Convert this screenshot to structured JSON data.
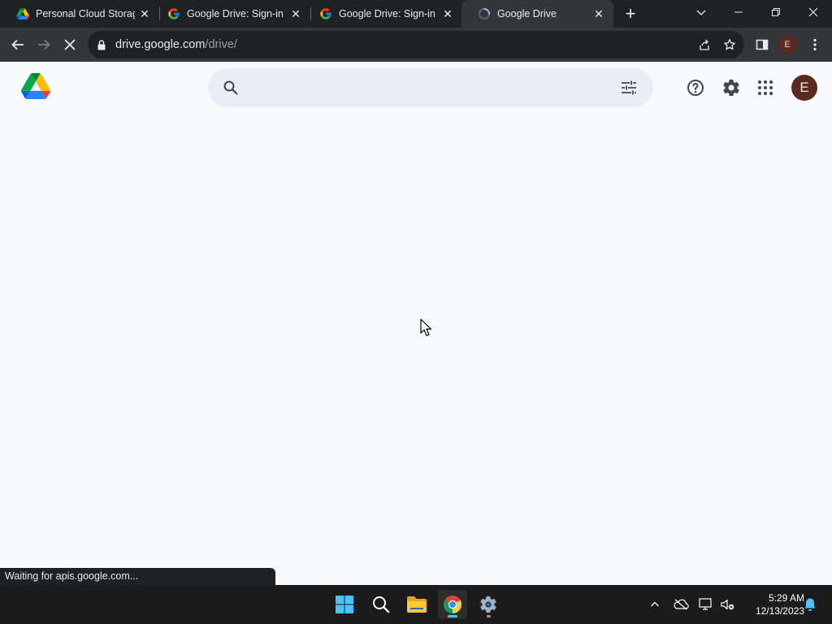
{
  "browser": {
    "tabs": [
      {
        "title": "Personal Cloud Storage",
        "favicon": "google-drive-icon",
        "active": false
      },
      {
        "title": "Google Drive: Sign-in",
        "favicon": "google-g-icon",
        "active": false
      },
      {
        "title": "Google Drive: Sign-in",
        "favicon": "google-g-icon",
        "active": false
      },
      {
        "title": "Google Drive",
        "favicon": "loading-spinner-icon",
        "active": true
      }
    ],
    "new_tab_symbol": "+",
    "close_symbol": "✕",
    "url_host": "drive.google.com",
    "url_path": "/drive/",
    "profile_initial": "E"
  },
  "page": {
    "search_placeholder": "",
    "search_value": "",
    "avatar_initial": "E"
  },
  "status_bubble": "Waiting for apis.google.com...",
  "taskbar": {
    "time": "5:29 AM",
    "date": "12/13/2023"
  },
  "colors": {
    "browser_frame": "#202124",
    "toolbar": "#35363a",
    "page_bg": "#f8fafd",
    "search_bg": "#e9eef6",
    "avatar_bg": "#5b2a1f",
    "taskbar_bg": "#1c1c1c",
    "accent_blue": "#4cc2ff"
  }
}
